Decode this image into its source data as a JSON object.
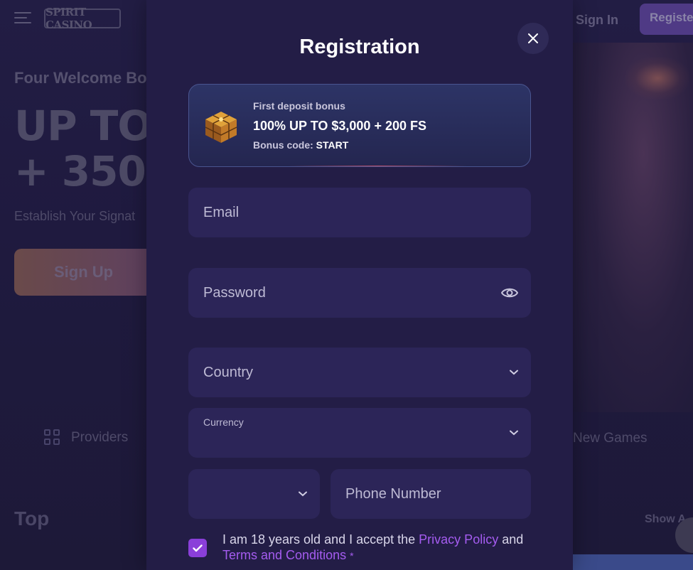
{
  "background": {
    "brand": "SPIRIT CASINO",
    "sign_in": "Sign In",
    "register": "Register",
    "hero_subtitle": "Four Welcome Bo",
    "hero_title_line1": "UP TO",
    "hero_title_line2": "+ 350",
    "hero_desc": "Establish Your Signat",
    "hero_cta": "Sign Up",
    "nav_providers": "Providers",
    "nav_new_games": "New Games",
    "section_top": "Top",
    "show_all": "Show A"
  },
  "modal": {
    "title": "Registration",
    "close_icon": "close-icon",
    "bonus": {
      "label": "First deposit bonus",
      "headline": "100% UP TO $3,000 + 200 FS",
      "code_prefix": "Bonus code:",
      "code": "START",
      "icon": "treasure-cube-icon"
    },
    "email_placeholder": "Email",
    "password_placeholder": "Password",
    "password_toggle_icon": "eye-icon",
    "country_placeholder": "Country",
    "currency_label": "Currency",
    "phone_code_value": "",
    "phone_placeholder": "Phone Number",
    "consent": {
      "checked": true,
      "text_before": "I am 18 years old and I accept the ",
      "privacy_link": "Privacy Policy",
      "text_middle": " and ",
      "terms_link": "Terms and Conditions",
      "required_mark": "*"
    }
  },
  "colors": {
    "modal_bg": "#231d46",
    "field_bg": "#2c2558",
    "accent": "#a55cf0",
    "checkbox": "#8a3fd9"
  }
}
